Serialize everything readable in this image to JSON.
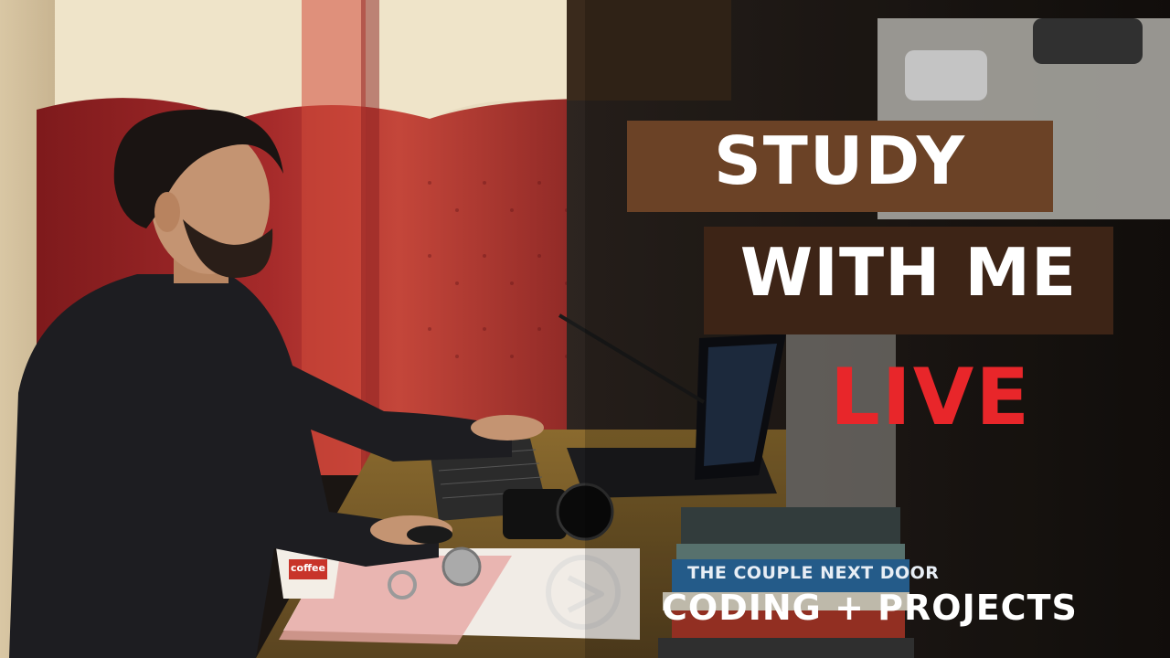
{
  "title_line1": "STUDY",
  "title_line2": "WITH ME",
  "live_label": "LIVE",
  "subtitle": "CODING + PROJECTS",
  "book_spine_text": "THE COUPLE NEXT DOOR",
  "cup_brand": "coffee",
  "colors": {
    "bar_light": "#6b4226",
    "bar_dark": "#3d2416",
    "live_red": "#e8262a",
    "text_white": "#ffffff"
  }
}
